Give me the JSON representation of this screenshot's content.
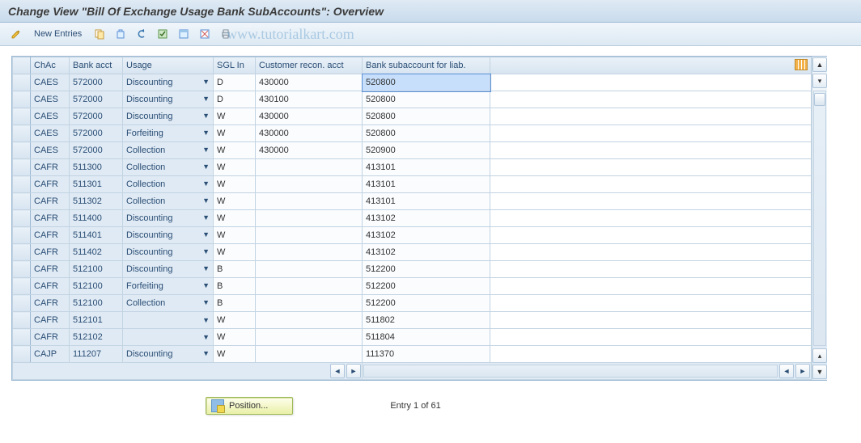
{
  "title": "Change View \"Bill Of Exchange Usage Bank SubAccounts\": Overview",
  "watermark": "www.tutorialkart.com",
  "toolbar": {
    "new_entries_label": "New Entries"
  },
  "columns": {
    "chac": "ChAc",
    "bank": "Bank acct",
    "usage": "Usage",
    "sgl": "SGL In",
    "recon": "Customer recon. acct",
    "sub": "Bank subaccount for liab."
  },
  "rows": [
    {
      "chac": "CAES",
      "bank": "572000",
      "usage": "Discounting",
      "sgl": "D",
      "recon": "430000",
      "sub": "520800",
      "highlight_sub": true
    },
    {
      "chac": "CAES",
      "bank": "572000",
      "usage": "Discounting",
      "sgl": "D",
      "recon": "430100",
      "sub": "520800"
    },
    {
      "chac": "CAES",
      "bank": "572000",
      "usage": "Discounting",
      "sgl": "W",
      "recon": "430000",
      "sub": "520800"
    },
    {
      "chac": "CAES",
      "bank": "572000",
      "usage": "Forfeiting",
      "sgl": "W",
      "recon": "430000",
      "sub": "520800"
    },
    {
      "chac": "CAES",
      "bank": "572000",
      "usage": "Collection",
      "sgl": "W",
      "recon": "430000",
      "sub": "520900"
    },
    {
      "chac": "CAFR",
      "bank": "511300",
      "usage": "Collection",
      "sgl": "W",
      "recon": "",
      "sub": "413101"
    },
    {
      "chac": "CAFR",
      "bank": "511301",
      "usage": "Collection",
      "sgl": "W",
      "recon": "",
      "sub": "413101"
    },
    {
      "chac": "CAFR",
      "bank": "511302",
      "usage": "Collection",
      "sgl": "W",
      "recon": "",
      "sub": "413101"
    },
    {
      "chac": "CAFR",
      "bank": "511400",
      "usage": "Discounting",
      "sgl": "W",
      "recon": "",
      "sub": "413102"
    },
    {
      "chac": "CAFR",
      "bank": "511401",
      "usage": "Discounting",
      "sgl": "W",
      "recon": "",
      "sub": "413102"
    },
    {
      "chac": "CAFR",
      "bank": "511402",
      "usage": "Discounting",
      "sgl": "W",
      "recon": "",
      "sub": "413102"
    },
    {
      "chac": "CAFR",
      "bank": "512100",
      "usage": "Discounting",
      "sgl": "B",
      "recon": "",
      "sub": "512200"
    },
    {
      "chac": "CAFR",
      "bank": "512100",
      "usage": "Forfeiting",
      "sgl": "B",
      "recon": "",
      "sub": "512200"
    },
    {
      "chac": "CAFR",
      "bank": "512100",
      "usage": "Collection",
      "sgl": "B",
      "recon": "",
      "sub": "512200"
    },
    {
      "chac": "CAFR",
      "bank": "512101",
      "usage": "",
      "sgl": "W",
      "recon": "",
      "sub": "511802"
    },
    {
      "chac": "CAFR",
      "bank": "512102",
      "usage": "",
      "sgl": "W",
      "recon": "",
      "sub": "511804"
    },
    {
      "chac": "CAJP",
      "bank": "111207",
      "usage": "Discounting",
      "sgl": "W",
      "recon": "",
      "sub": "111370"
    }
  ],
  "footer": {
    "position_label": "Position...",
    "entry_text": "Entry 1 of 61"
  }
}
